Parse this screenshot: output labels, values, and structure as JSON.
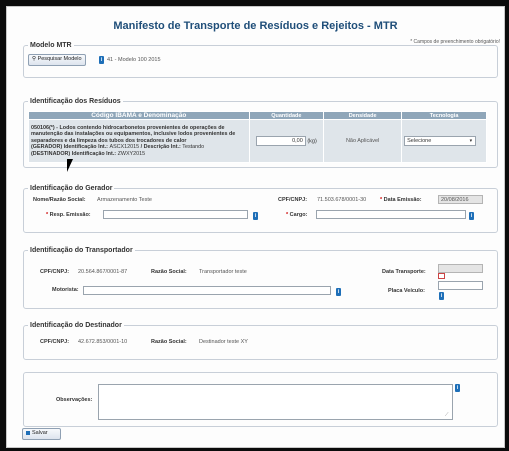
{
  "header": {
    "title": "Manifesto de Transporte de Resíduos e Rejeitos - MTR",
    "required_note": "* Campos de preenchimento obrigatório!"
  },
  "modelo": {
    "legend": "Modelo MTR",
    "search_button": "Pesquisar Modelo",
    "selected": "41 - Modelo 100 2015"
  },
  "residuos": {
    "legend": "Identificação dos Resíduos",
    "columns": [
      "Código IBAMA e Denominação",
      "Quantidade",
      "Densidade",
      "Tecnologia"
    ],
    "rows": [
      {
        "code": "050106(*)",
        "description": " - Lodos contendo hidrocarbonetos provenientes de operações de manutenção das instalações ou equipamentos, inclusive lodos provenientes de separadores e da limpeza dos tubos dos trocadores de calor",
        "gerador_prefix": "(GERADOR) Identificação Int.: ",
        "gerador_id": "ASCX12015",
        "desc_prefix": " / Descrição Int.: ",
        "desc_value": "Testando",
        "destinador_prefix": "(DESTINADOR) Identificação Int.: ",
        "destinador_id": "ZWXY2015",
        "quantity": "0,00",
        "unit": "(kg)",
        "density": "Não Aplicável",
        "technology": "Selecione"
      }
    ]
  },
  "gerador": {
    "legend": "Identificação do Gerador",
    "name_label": "Nome/Razão Social:",
    "name_value": "Armazenamento Teste",
    "cpf_label": "CPF/CNPJ:",
    "cpf_value": "71.503.678/0001-30",
    "emission_label": "Data Emissão:",
    "emission_value": "20/08/2016",
    "resp_label": "Resp. Emissão:",
    "cargo_label": "Cargo:"
  },
  "transportador": {
    "legend": "Identificação do Transportador",
    "cpf_label": "CPF/CNPJ:",
    "cpf_value": "20.564.867/0001-87",
    "razao_label": "Razão Social:",
    "razao_value": "Transportador teste",
    "date_label": "Data Transporte:",
    "motorista_label": "Motorista:",
    "placa_label": "Placa Veículo:"
  },
  "destinador": {
    "legend": "Identificação do Destinador",
    "cpf_label": "CPF/CNPJ:",
    "cpf_value": "42.672.853/0001-10",
    "razao_label": "Razão Social:",
    "razao_value": "Destinador teste XY"
  },
  "observacoes": {
    "label": "Observações:"
  },
  "footer": {
    "save_button": "Salvar"
  },
  "marks": {
    "required": "*",
    "info": "i",
    "arrow": "▾"
  }
}
